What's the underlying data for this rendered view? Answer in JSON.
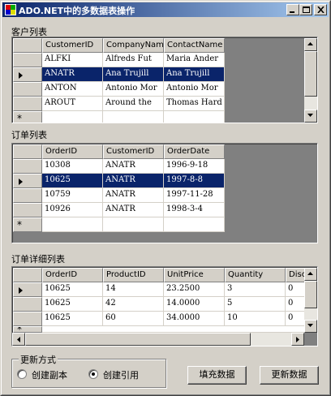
{
  "window": {
    "title": "ADO.NET中的多数据表操作"
  },
  "customers": {
    "label": "客户列表",
    "columns": [
      "CustomerID",
      "CompanyName",
      "ContactName"
    ],
    "rows": [
      [
        "ALFKI",
        "Alfreds Fut",
        "Maria Ander"
      ],
      [
        "ANATR",
        "Ana Trujill",
        "Ana Trujill"
      ],
      [
        "ANTON",
        "Antonio Mor",
        "Antonio Mor"
      ],
      [
        "AROUT",
        "Around the",
        "Thomas Hard"
      ]
    ],
    "selected_row": 1,
    "new_row_marker": "*"
  },
  "orders": {
    "label": "订单列表",
    "columns": [
      "OrderID",
      "CustomerID",
      "OrderDate"
    ],
    "rows": [
      [
        "10308",
        "ANATR",
        "1996-9-18"
      ],
      [
        "10625",
        "ANATR",
        "1997-8-8"
      ],
      [
        "10759",
        "ANATR",
        "1997-11-28"
      ],
      [
        "10926",
        "ANATR",
        "1998-3-4"
      ]
    ],
    "selected_row": 1,
    "new_row_marker": "*"
  },
  "details": {
    "label": "订单详细列表",
    "columns": [
      "OrderID",
      "ProductID",
      "UnitPrice",
      "Quantity",
      "Disc"
    ],
    "rows": [
      [
        "10625",
        "14",
        "23.2500",
        "3",
        "0"
      ],
      [
        "10625",
        "42",
        "14.0000",
        "5",
        "0"
      ],
      [
        "10625",
        "60",
        "34.0000",
        "10",
        "0"
      ]
    ],
    "new_row_marker": "*"
  },
  "update_mode": {
    "label": "更新方式",
    "options": [
      "创建副本",
      "创建引用"
    ],
    "selected": 1
  },
  "buttons": {
    "fill": "填充数据",
    "update": "更新数据"
  },
  "icons": {
    "app": "app-icon",
    "minimize": "minimize-icon",
    "maximize": "maximize-icon",
    "close": "close-icon",
    "row_pointer": "row-pointer-icon"
  }
}
